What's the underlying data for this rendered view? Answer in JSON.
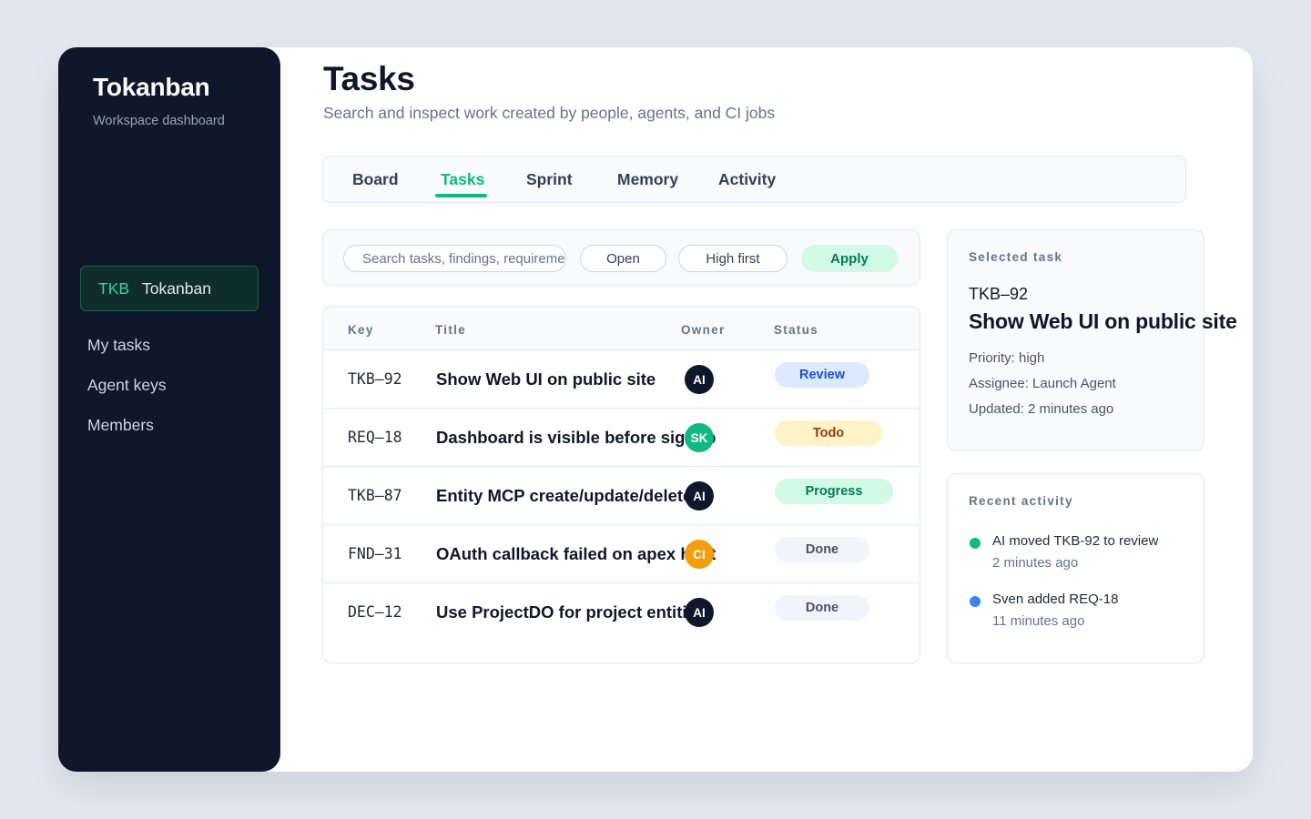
{
  "sidebar": {
    "brand_title": "Tokanban",
    "brand_subtitle": "Workspace dashboard",
    "project": {
      "key": "TKB",
      "name": "Tokanban"
    },
    "nav": [
      "My tasks",
      "Agent keys",
      "Members"
    ]
  },
  "header": {
    "title": "Tasks",
    "subtitle": "Search and inspect work created by people, agents, and CI jobs"
  },
  "tabs": [
    "Board",
    "Tasks",
    "Sprint",
    "Memory",
    "Activity"
  ],
  "active_tab": "Tasks",
  "filters": {
    "search_placeholder": "Search tasks, findings, requirements",
    "status_filter": "Open",
    "sort": "High first",
    "apply_label": "Apply"
  },
  "table": {
    "columns": [
      "Key",
      "Title",
      "Owner",
      "Status"
    ],
    "rows": [
      {
        "key": "TKB–92",
        "title": "Show Web UI on public site",
        "owner": "AI",
        "owner_color": "#0f172a",
        "status": "Review",
        "status_bg": "#dbeafe",
        "status_fg": "#1d4ed8"
      },
      {
        "key": "REQ–18",
        "title": "Dashboard is visible before signup",
        "owner": "SK",
        "owner_color": "#10b981",
        "status": "Todo",
        "status_bg": "#fef3c7",
        "status_fg": "#92400e"
      },
      {
        "key": "TKB–87",
        "title": "Entity MCP create/update/delete",
        "owner": "AI",
        "owner_color": "#0f172a",
        "status": "Progress",
        "status_bg": "#d1fae5",
        "status_fg": "#047857"
      },
      {
        "key": "FND–31",
        "title": "OAuth callback failed on apex host",
        "owner": "CI",
        "owner_color": "#f59e0b",
        "status": "Done",
        "status_bg": "#f1f5f9",
        "status_fg": "#475569"
      },
      {
        "key": "DEC–12",
        "title": "Use ProjectDO for project entities",
        "owner": "AI",
        "owner_color": "#0f172a",
        "status": "Done",
        "status_bg": "#f1f5f9",
        "status_fg": "#475569"
      }
    ]
  },
  "selected_task": {
    "label": "Selected task",
    "key": "TKB–92",
    "title": "Show Web UI on public site",
    "priority": "Priority: high",
    "assignee": "Assignee: Launch Agent",
    "updated": "Updated: 2 minutes ago"
  },
  "recent_activity": {
    "label": "Recent activity",
    "items": [
      {
        "text": "AI moved TKB-92 to review",
        "time": "2 minutes ago",
        "color": "#10b981"
      },
      {
        "text": "Sven added REQ-18",
        "time": "11 minutes ago",
        "color": "#3b82f6"
      }
    ]
  }
}
